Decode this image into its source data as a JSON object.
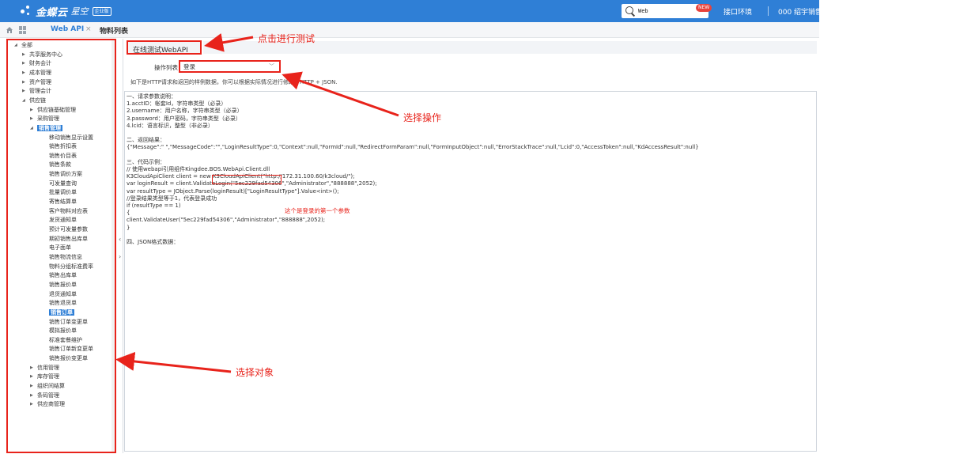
{
  "header": {
    "logo_name": "金蝶云",
    "logo_sub": "星空",
    "logo_tag": "企业版",
    "search_value": "Web",
    "new_badge": "NEW",
    "env_label": "接口环境",
    "user_label": "000 绍宇销售"
  },
  "tabs": {
    "webapi": "Web API",
    "close": "×",
    "material": "物料列表"
  },
  "sidebar": {
    "items": [
      {
        "caret": "◢",
        "label": "全部"
      },
      {
        "caret": "▶",
        "label": "共享服务中心"
      },
      {
        "caret": "▶",
        "label": "财务会计"
      },
      {
        "caret": "▶",
        "label": "成本管理"
      },
      {
        "caret": "▶",
        "label": "资产管理"
      },
      {
        "caret": "▶",
        "label": "管理会计"
      },
      {
        "caret": "◢",
        "label": "供应链"
      },
      {
        "caret": "▶",
        "label": "供应链基础管理"
      },
      {
        "caret": "▶",
        "label": "采购管理"
      },
      {
        "caret": "◢",
        "label": "销售管理"
      },
      {
        "caret": "",
        "label": "移动销售显示设置"
      },
      {
        "caret": "",
        "label": "销售折扣表"
      },
      {
        "caret": "",
        "label": "销售价目表"
      },
      {
        "caret": "",
        "label": "销售条款"
      },
      {
        "caret": "",
        "label": "销售调价方案"
      },
      {
        "caret": "",
        "label": "可发量查询"
      },
      {
        "caret": "",
        "label": "批量调价单"
      },
      {
        "caret": "",
        "label": "寄售结算单"
      },
      {
        "caret": "",
        "label": "客户物料对应表"
      },
      {
        "caret": "",
        "label": "发货通知单"
      },
      {
        "caret": "",
        "label": "预计可发量参数"
      },
      {
        "caret": "",
        "label": "期初销售出库单"
      },
      {
        "caret": "",
        "label": "电子面单"
      },
      {
        "caret": "",
        "label": "销售物流信息"
      },
      {
        "caret": "",
        "label": "物料分组标准费率"
      },
      {
        "caret": "",
        "label": "销售出库单"
      },
      {
        "caret": "",
        "label": "销售报价单"
      },
      {
        "caret": "",
        "label": "退货通知单"
      },
      {
        "caret": "",
        "label": "销售退货单"
      },
      {
        "caret": "",
        "label": "销售订单"
      },
      {
        "caret": "",
        "label": "销售订单变更单"
      },
      {
        "caret": "",
        "label": "模拟报价单"
      },
      {
        "caret": "",
        "label": "标准套餐维护"
      },
      {
        "caret": "",
        "label": "销售订单新变更单"
      },
      {
        "caret": "",
        "label": "销售报价变更单"
      },
      {
        "caret": "▶",
        "label": "信用管理"
      },
      {
        "caret": "▶",
        "label": "库存管理"
      },
      {
        "caret": "▶",
        "label": "组织间结算"
      },
      {
        "caret": "▶",
        "label": "条码管理"
      },
      {
        "caret": "▶",
        "label": "供应商管理"
      }
    ]
  },
  "main": {
    "panel_title": "在线测试WebAPI",
    "op_label": "操作列表",
    "op_value": "登录",
    "op_chevron": "﹀",
    "desc": "如下是HTTP请求和返回的样例数据，你可以根据实际情况进行修改，HTTP + JSON.",
    "code_lines": [
      "一、请求参数说明：",
      "1.acctID：帐套Id，字符串类型（必录）",
      "2.username：用户名称，字符串类型（必录）",
      "3.password：用户密码，字符串类型（必录）",
      "4.lcid：语言标识，整型（非必录）",
      "",
      "二、返回结果：",
      "{\"Message\":\" \",\"MessageCode\":\"\",\"LoginResultType\":0,\"Context\":null,\"FormId\":null,\"RedirectFormParam\":null,\"FormInputObject\":null,\"ErrorStackTrace\":null,\"Lcid\":0,\"AccessToken\":null,\"KdAccessResult\":null}",
      "",
      "三、代码示例：",
      "// 使用webapi引用组件Kingdee.BOS.WebApi.Client.dll",
      "K3CloudApiClient client = new K3CloudApiClient(\"http://172.31.100.60/k3cloud/\");",
      "var loginResult = client.ValidateLogin(\"5ec229fad54306\",\"Administrator\",\"888888\",2052);",
      "var resultType = JObject.Parse(loginResult)[\"LoginResultType\"].Value<int>();",
      "//登录结果类型等于1，代表登录成功",
      "if (resultType == 1)",
      "{",
      "        client.ValidateUser(\"5ec229fad54306\",\"Administrator\",\"888888\",2052);",
      "}",
      "",
      "四、JSON格式数据："
    ],
    "note_red": "这个是登录的第一个参数"
  },
  "annotations": {
    "click_test": "点击进行测试",
    "select_op": "选择操作",
    "select_obj": "选择对象"
  },
  "colors": {
    "accent": "#2f7fd6",
    "annotation_red": "#e8231b"
  }
}
